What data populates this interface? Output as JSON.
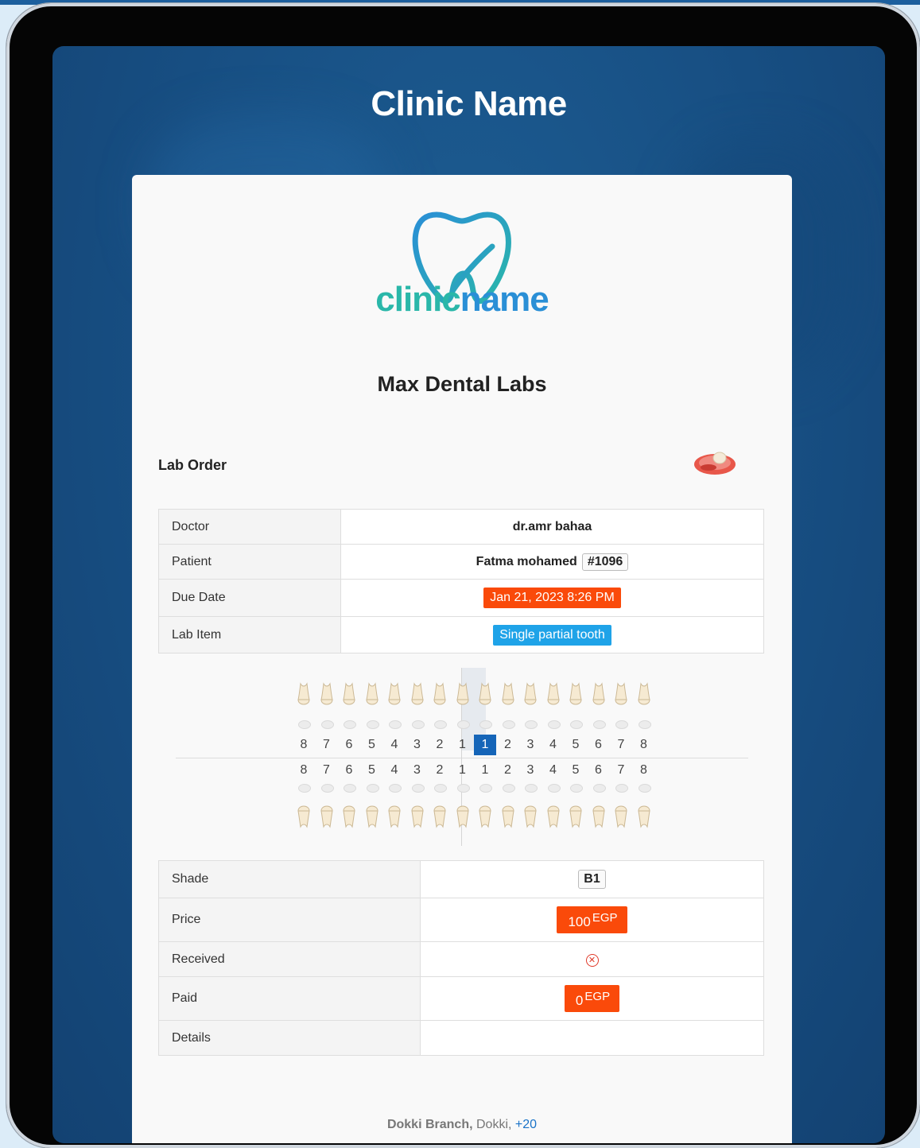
{
  "clinic_title": "Clinic Name",
  "logo_text_part1": "clinic",
  "logo_text_part2": "name",
  "lab_name": "Max Dental Labs",
  "section_title": "Lab Order",
  "order": {
    "doctor_label": "Doctor",
    "doctor_value": "dr.amr bahaa",
    "patient_label": "Patient",
    "patient_name": "Fatma mohamed",
    "patient_id": "#1096",
    "due_label": "Due Date",
    "due_value": "Jan 21, 2023 8:26 PM",
    "item_label": "Lab Item",
    "item_value": "Single partial tooth"
  },
  "tooth_chart": {
    "upper_numbers": [
      "8",
      "7",
      "6",
      "5",
      "4",
      "3",
      "2",
      "1",
      "1",
      "2",
      "3",
      "4",
      "5",
      "6",
      "7",
      "8"
    ],
    "lower_numbers": [
      "8",
      "7",
      "6",
      "5",
      "4",
      "3",
      "2",
      "1",
      "1",
      "2",
      "3",
      "4",
      "5",
      "6",
      "7",
      "8"
    ],
    "selected": "upper-left-1"
  },
  "details": {
    "shade_label": "Shade",
    "shade_value": "B1",
    "price_label": "Price",
    "price_amount": "100",
    "price_currency": "EGP",
    "received_label": "Received",
    "received_icon": "x-circle-icon",
    "paid_label": "Paid",
    "paid_amount": "0",
    "paid_currency": "EGP",
    "details_label": "Details",
    "details_value": ""
  },
  "footer": {
    "branch": "Dokki Branch,",
    "area": "Dokki,",
    "phone": "+20"
  },
  "colors": {
    "background": "#174e82",
    "badge_orange": "#fa4a0a",
    "badge_blue": "#1fa3e8",
    "selected_tooth": "#1565b8",
    "logo_teal": "#2ab7a9",
    "logo_blue": "#2a8fd6"
  }
}
